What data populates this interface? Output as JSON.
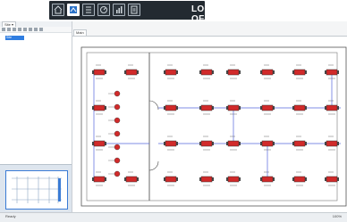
{
  "topbar": {
    "logoff_label": "LOG OFF",
    "nav_icons": [
      "home-icon",
      "map-icon",
      "list-icon",
      "gauge-icon",
      "bar-chart-icon",
      "report-icon"
    ],
    "active_index": 1
  },
  "left": {
    "tab_label": "Site ▾",
    "tree_root": "Site",
    "minimap_label": ""
  },
  "main": {
    "doc_tab": "Main"
  },
  "colors": {
    "nav_bg": "#232a31",
    "accent": "#3a7bd5",
    "unit_red": "#d12a2a",
    "wire_blue": "#5566dd"
  },
  "status": {
    "left": "Ready",
    "right": "100%"
  }
}
